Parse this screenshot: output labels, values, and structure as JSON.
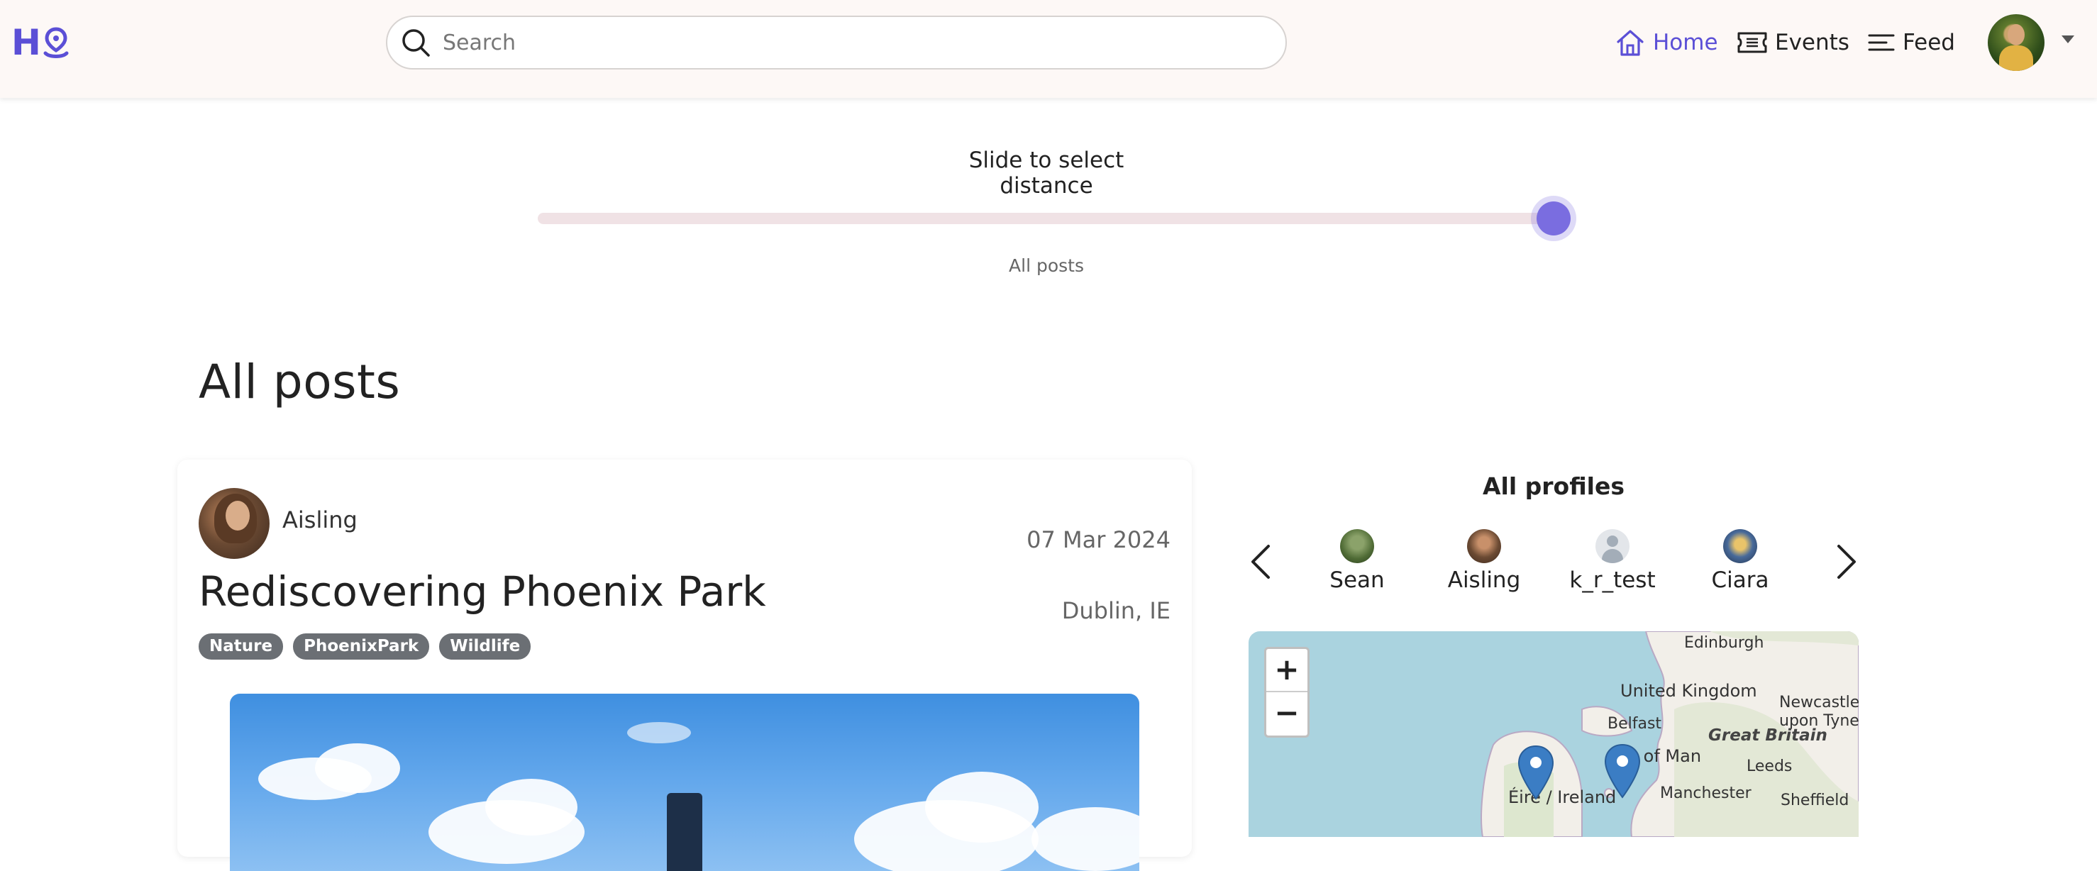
{
  "nav": {
    "logo_text": "H",
    "search_placeholder": "Search",
    "links": [
      {
        "label": "Home",
        "icon": "home-icon",
        "active": true
      },
      {
        "label": "Events",
        "icon": "ticket-icon",
        "active": false
      },
      {
        "label": "Feed",
        "icon": "feed-icon",
        "active": false
      }
    ]
  },
  "slider": {
    "label": "Slide to select distance",
    "value_text": "All posts",
    "position_fraction": 1.0
  },
  "page_title": "All posts",
  "post": {
    "author": "Aisling",
    "date": "07 Mar 2024",
    "title": "Rediscovering Phoenix Park",
    "location": "Dublin, IE",
    "tags": [
      "Nature",
      "PhoenixPark",
      "Wildlife"
    ]
  },
  "profiles": {
    "title": "All profiles",
    "items": [
      {
        "name": "Sean"
      },
      {
        "name": "Aisling"
      },
      {
        "name": "k_r_test"
      },
      {
        "name": "Ciara"
      }
    ]
  },
  "map": {
    "zoom_in": "+",
    "zoom_out": "−",
    "labels": {
      "edinburgh": "Edinburgh",
      "uk": "United Kingdom",
      "newcastle_1": "Newcastle",
      "newcastle_2": "upon Tyne",
      "belfast": "Belfast",
      "great_britain": "Great Britain",
      "isle_of_man": "Isle of Man",
      "leeds": "Leeds",
      "eire": "Éire / Ireland",
      "manchester": "Manchester",
      "sheffield": "Sheffield"
    }
  },
  "colors": {
    "accent": "#5b4fd6",
    "navbar_bg": "#fdf8f6",
    "tag_bg": "#6b6f74",
    "marker": "#3b7dc4",
    "sea": "#aad3df"
  }
}
